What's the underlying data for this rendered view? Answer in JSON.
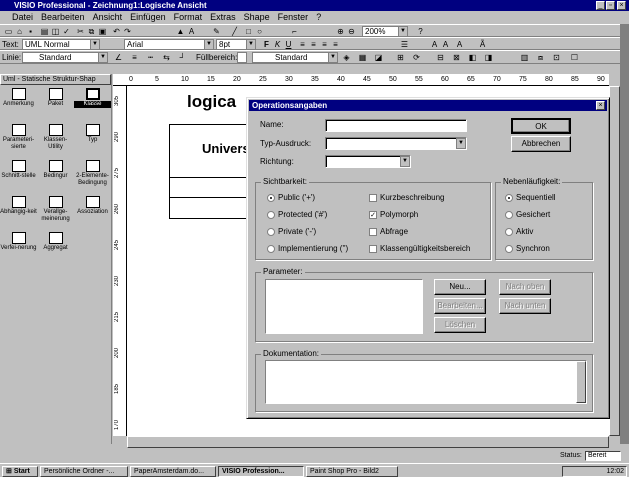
{
  "app": {
    "title": "VISIO Professional - Zeichnung1:Logische Ansicht"
  },
  "menu": [
    "Datei",
    "Bearbeiten",
    "Ansicht",
    "Einfügen",
    "Format",
    "Extras",
    "Shape",
    "Fenster",
    "?"
  ],
  "toolbar": {
    "zoom": "200%",
    "text_style": "UML Normal",
    "font": "Arial",
    "font_size": "8pt",
    "line_label": "Linie:",
    "line_style": "Standard",
    "fill_label": "Füllbereich:",
    "fill_style": "Standard",
    "text_label": "Text:"
  },
  "stencil": {
    "title": "Uml - Statische Struktur-Shap",
    "shapes": [
      "Anmerkung",
      "Paket",
      "Klasse",
      "Parameteri-sierte",
      "Klassen-Utility",
      "Typ",
      "Schnitt-stelle",
      "Bedingur",
      "2-Elemente-Bedingung",
      "Abhängig-keit",
      "Verallge-meinerung",
      "Assoziation",
      "Verfei-nerung",
      "Aggregat"
    ]
  },
  "canvas": {
    "heading": "logica",
    "class_name": "Univers"
  },
  "ruler": {
    "h": [
      "0",
      "5",
      "10",
      "15",
      "20",
      "25",
      "30",
      "35",
      "40",
      "45",
      "50",
      "55",
      "60",
      "65",
      "70",
      "75",
      "80",
      "85",
      "90"
    ],
    "v": [
      "305",
      "290",
      "275",
      "260",
      "245",
      "230",
      "215",
      "200",
      "185",
      "170"
    ]
  },
  "dialog": {
    "title": "Operationsangaben",
    "name_label": "Name:",
    "name_value": "",
    "type_label": "Typ-Ausdruck:",
    "direction_label": "Richtung:",
    "ok": "OK",
    "cancel": "Abbrechen",
    "visibility": {
      "title": "Sichtbarkeit:",
      "options": [
        "Public ('+')",
        "Protected ('#')",
        "Private ('-')",
        "Implementierung ('')"
      ]
    },
    "flags": {
      "options": [
        "Kurzbeschreibung",
        "Polymorph",
        "Abfrage",
        "Klassengültigkeitsbereich"
      ],
      "checked": [
        false,
        true,
        false,
        false
      ]
    },
    "concurrency": {
      "title": "Nebenläufigkeit:",
      "options": [
        "Sequentiell",
        "Gesichert",
        "Aktiv",
        "Synchron"
      ]
    },
    "params": {
      "title": "Parameter:",
      "new": "Neu...",
      "edit": "Bearbeiten...",
      "delete": "Löschen",
      "down": "Nach oben",
      "up": "Nach unten"
    },
    "doc": {
      "title": "Dokumentation:"
    }
  },
  "status": {
    "text": "Status:",
    "value": "Bereit"
  },
  "taskbar": {
    "start": "Start",
    "items": [
      "Persönliche Ordner -...",
      "PaperAmsterdam.do...",
      "VISIO Profession...",
      "Paint Shop Pro - Bild2"
    ],
    "clock": "12:02"
  }
}
